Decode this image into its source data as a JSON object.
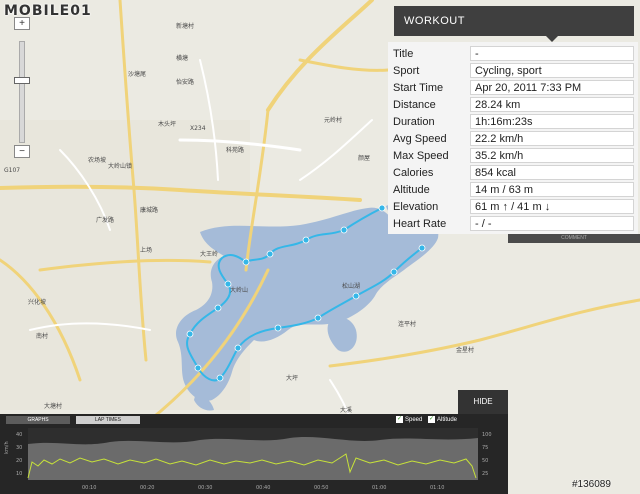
{
  "logo": "MOBILE01",
  "zoom": {
    "plus": "+",
    "minus": "−",
    "level": 0.38
  },
  "workout": {
    "header": "WORKOUT",
    "fields": [
      {
        "label": "Title",
        "value": "-"
      },
      {
        "label": "Sport",
        "value": "Cycling, sport"
      },
      {
        "label": "Start Time",
        "value": "Apr 20, 2011 7:33 PM"
      },
      {
        "label": "Distance",
        "value": "28.24 km"
      },
      {
        "label": "Duration",
        "value": "1h:16m:23s"
      },
      {
        "label": "Avg Speed",
        "value": "22.2 km/h"
      },
      {
        "label": "Max Speed",
        "value": "35.2 km/h"
      },
      {
        "label": "Calories",
        "value": "854 kcal"
      },
      {
        "label": "Altitude",
        "value": "14 m / 63 m"
      },
      {
        "label": "Elevation",
        "value": "61 m ↑ / 41 m ↓"
      },
      {
        "label": "Heart Rate",
        "value": "- / -"
      }
    ]
  },
  "comment_label": "COMMENT",
  "hide_label": "HIDE",
  "graph": {
    "tabs": [
      "GRAPHS",
      "LAP TIMES"
    ],
    "legend": [
      "Speed",
      "Altitude"
    ],
    "time_ticks": [
      "00:10",
      "00:20",
      "00:30",
      "00:40",
      "00:50",
      "01:00",
      "01:10"
    ],
    "left_ticks": [
      "40",
      "30",
      "20",
      "10"
    ],
    "right_ticks": [
      "100",
      "75",
      "50",
      "25"
    ],
    "left_axis_label": "km/h"
  },
  "watermark": "#136089",
  "map_labels": [
    "大岭山镇",
    "上场",
    "广发路",
    "大岭山",
    "农场坡",
    "康城路",
    "木头坪",
    "大坪",
    "松山湖",
    "元岭村",
    "大溪",
    "大塘村",
    "南村",
    "新塘村",
    "颜屋",
    "沙塘尾",
    "科苑路",
    "X234",
    "G107",
    "金星村",
    "连平村",
    "横塘",
    "怡安路",
    "大王岭",
    "兴化坡"
  ]
}
